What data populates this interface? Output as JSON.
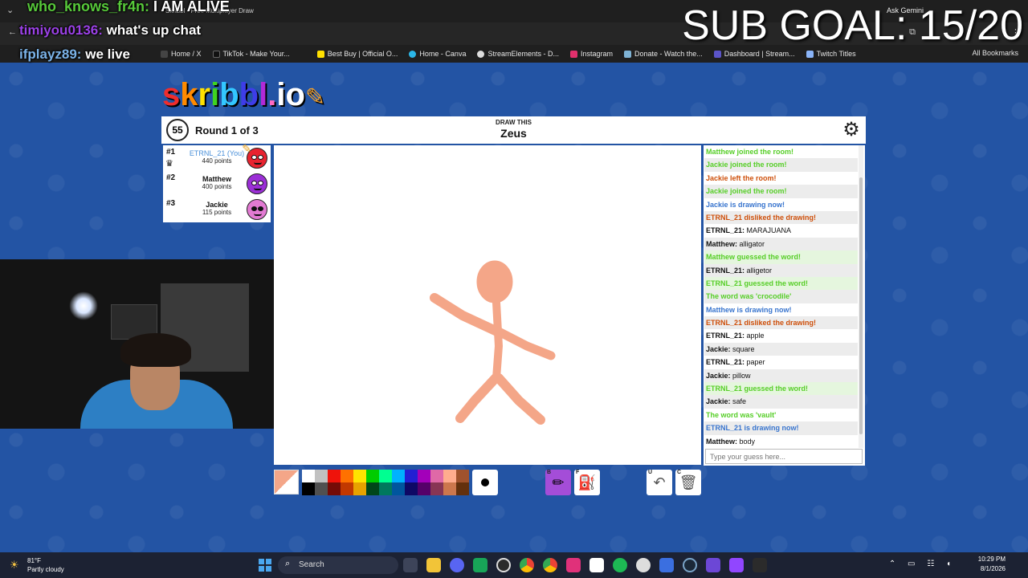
{
  "browser": {
    "tab_title": "Skribbl - Free Multiplayer Draw",
    "bookmarks": [
      "Home / X",
      "TikTok - Make Your...",
      "Best Buy | Official O...",
      "Home - Canva",
      "StreamElements - D...",
      "Instagram",
      "Donate - Watch the...",
      "Dashboard | Stream...",
      "Twitch Titles"
    ],
    "all_bookmarks": "All Bookmarks",
    "ask_gemini": "Ask Gemini"
  },
  "overlay": {
    "chat1_user": "who_knows_fr4n:",
    "chat1_text": "I AM ALIVE",
    "chat2_user": "timiyou0136:",
    "chat2_text": "what's up chat",
    "chat3_user": "ifplayz89:",
    "chat3_text": "we live",
    "sub_goal": "SUB GOAL: 15/20"
  },
  "logo": {
    "letters": [
      "s",
      "k",
      "r",
      "i",
      "b",
      "b",
      "l",
      ".",
      "i",
      "o"
    ]
  },
  "game": {
    "timer": "55",
    "round": "Round 1 of 3",
    "draw_this_label": "DRAW THIS",
    "word": "Zeus"
  },
  "players": [
    {
      "rank": "#1",
      "name": "ETRNL_21 (You)",
      "points": "440 points",
      "you": true,
      "avatar_color": "#e8232f"
    },
    {
      "rank": "#2",
      "name": "Matthew",
      "points": "400 points",
      "you": false,
      "avatar_color": "#9b2fd6"
    },
    {
      "rank": "#3",
      "name": "Jackie",
      "points": "115 points",
      "you": false,
      "avatar_color": "#e27ad2"
    }
  ],
  "chat": {
    "messages": [
      {
        "type": "green",
        "text": "Matthew joined the room!"
      },
      {
        "type": "green",
        "text": "Jackie joined the room!"
      },
      {
        "type": "orange",
        "text": "Jackie left the room!"
      },
      {
        "type": "green",
        "text": "Jackie joined the room!"
      },
      {
        "type": "blue",
        "text": "Jackie is drawing now!"
      },
      {
        "type": "orange",
        "text": "ETRNL_21 disliked the drawing!"
      },
      {
        "type": "chat",
        "author": "ETRNL_21:",
        "text": " MARAJUANA"
      },
      {
        "type": "chat",
        "author": "Matthew:",
        "text": " alligator"
      },
      {
        "type": "green-hl",
        "text": "Matthew guessed the word!"
      },
      {
        "type": "chat",
        "author": "ETRNL_21:",
        "text": " alligetor"
      },
      {
        "type": "green-hl",
        "text": "ETRNL_21 guessed the word!"
      },
      {
        "type": "green",
        "text": "The word was 'crocodile'"
      },
      {
        "type": "blue",
        "text": "Matthew is drawing now!"
      },
      {
        "type": "orange",
        "text": "ETRNL_21 disliked the drawing!"
      },
      {
        "type": "chat",
        "author": "ETRNL_21:",
        "text": " apple"
      },
      {
        "type": "chat",
        "author": "Jackie:",
        "text": " square"
      },
      {
        "type": "chat",
        "author": "ETRNL_21:",
        "text": " paper"
      },
      {
        "type": "chat",
        "author": "Jackie:",
        "text": " pillow"
      },
      {
        "type": "green-hl",
        "text": "ETRNL_21 guessed the word!"
      },
      {
        "type": "chat",
        "author": "Jackie:",
        "text": " safe"
      },
      {
        "type": "green",
        "text": "The word was 'vault'"
      },
      {
        "type": "blue",
        "text": "ETRNL_21 is drawing now!"
      },
      {
        "type": "chat",
        "author": "Matthew:",
        "text": " body"
      }
    ],
    "input_placeholder": "Type your guess here..."
  },
  "toolbar": {
    "current_color": "#f4a688",
    "palette_row1": [
      "#ffffff",
      "#c1c1c1",
      "#ef130b",
      "#ff7100",
      "#ffe400",
      "#00cc00",
      "#00ff91",
      "#00b2ff",
      "#231fd3",
      "#a300ba",
      "#df69a7",
      "#ffac8e",
      "#a0522d"
    ],
    "palette_row2": [
      "#000000",
      "#505050",
      "#740b07",
      "#c23800",
      "#e8a200",
      "#004619",
      "#00785d",
      "#00569e",
      "#0e0865",
      "#550069",
      "#873554",
      "#cc774d",
      "#63300d"
    ],
    "pen_key": "B",
    "fill_key": "F",
    "undo_key": "U",
    "clear_key": "C"
  },
  "drawing": {
    "color": "#f4a688"
  },
  "taskbar": {
    "temp": "81°F",
    "weather": "Partly cloudy",
    "search": "Search",
    "time": "10:29 PM",
    "date": "8/1/2026"
  }
}
